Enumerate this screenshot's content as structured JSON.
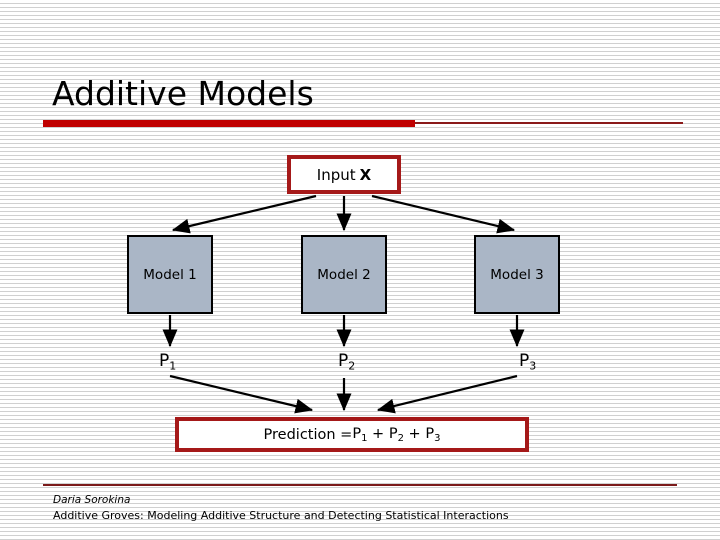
{
  "slide": {
    "title": "Additive Models",
    "accent_color": "#c00000",
    "accent_dark_color": "#a51919",
    "model_box_color": "#aab6c6"
  },
  "diagram": {
    "input": {
      "label_main": "Input",
      "label_bold": "X"
    },
    "models": [
      {
        "label": "Model 1"
      },
      {
        "label": "Model 2"
      },
      {
        "label": "Model 3"
      }
    ],
    "predictions": [
      {
        "base": "P",
        "sub": "1"
      },
      {
        "base": "P",
        "sub": "2"
      },
      {
        "base": "P",
        "sub": "3"
      }
    ],
    "result": {
      "prefix": "Prediction = ",
      "term_base": "P",
      "term_subs": [
        "1",
        "2",
        "3"
      ],
      "operator": " + "
    }
  },
  "footer": {
    "author": "Daria Sorokina",
    "subtitle": "Additive Groves: Modeling Additive Structure and Detecting Statistical Interactions"
  }
}
